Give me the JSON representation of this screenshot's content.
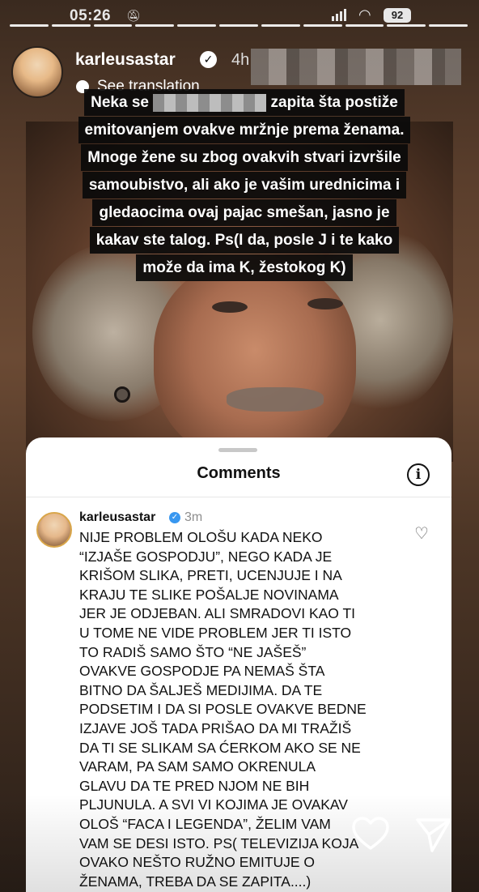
{
  "status_bar": {
    "time": "05:26",
    "battery": "92"
  },
  "story": {
    "progress_segments": 11,
    "active_segments": 11,
    "username": "karleusastar",
    "time_ago": "4h",
    "see_translation": "See translation",
    "caption_lines": [
      [
        "Neka se",
        "zapita šta postiže"
      ],
      [
        "emitovanjem ovakve mržnje prema ženama."
      ],
      [
        "Mnoge žene su zbog ovakvih stvari izvršile"
      ],
      [
        "samoubistvo, ali ako je vašim urednicima i"
      ],
      [
        "gledaocima ovaj pajac smešan, jasno je"
      ],
      [
        "kakav ste talog. Ps(I da, posle J i te kako"
      ],
      [
        "može da ima K, žestokog K)"
      ]
    ]
  },
  "comments_sheet": {
    "title": "Comments",
    "comment": {
      "username": "karleusastar",
      "time_ago": "3m",
      "lines": [
        "NIJE PROBLEM OLOŠU KADA NEKO",
        "“IZJAŠE GOSPODJU”, NEGO KADA JE",
        "KRIŠOM SLIKA, PRETI, UCENJUJE I NA",
        "KRAJU TE SLIKE POŠALJE NOVINAMA",
        "JER JE ODJEBAN. ALI SMRADOVI KAO TI",
        "U TOME NE VIDE PROBLEM JER TI ISTO",
        "TO RADIŠ SAMO ŠTO “NE JAŠEŠ”",
        "OVAKVE GOSPODJE PA NEMAŠ ŠTA",
        "BITNO DA ŠALJEŠ MEDIJIMA. DA TE",
        "PODSETIM I DA SI POSLE OVAKVE BEDNE",
        "IZJAVE JOŠ TADA PRIŠAO DA MI TRAŽIŠ",
        "DA TI SE SLIKAM SA ĆERKOM AKO SE NE",
        "VARAM, PA SAM SAMO OKRENULA",
        "GLAVU DA TE PRED NJOM NE BIH",
        "PLJUNULA. A SVI VI KOJIMA JE OVAKAV",
        "OLOŠ “FACA I LEGENDA”, ŽELIM VAM",
        "VAM SE DESI ISTO. PS( TELEVIZIJA KOJA",
        "OVAKO NEŠTO RUŽNO EMITUJE O",
        "ŽENAMA, TREBA DA SE ZAPITA....)"
      ]
    }
  },
  "icons": {
    "status_bell": "bell-muted-icon",
    "verified": "verified-badge-icon",
    "translate": "translate-icon",
    "info": "info-icon",
    "heart": "heart-icon",
    "like": "like-heart-icon",
    "share": "send-icon"
  }
}
